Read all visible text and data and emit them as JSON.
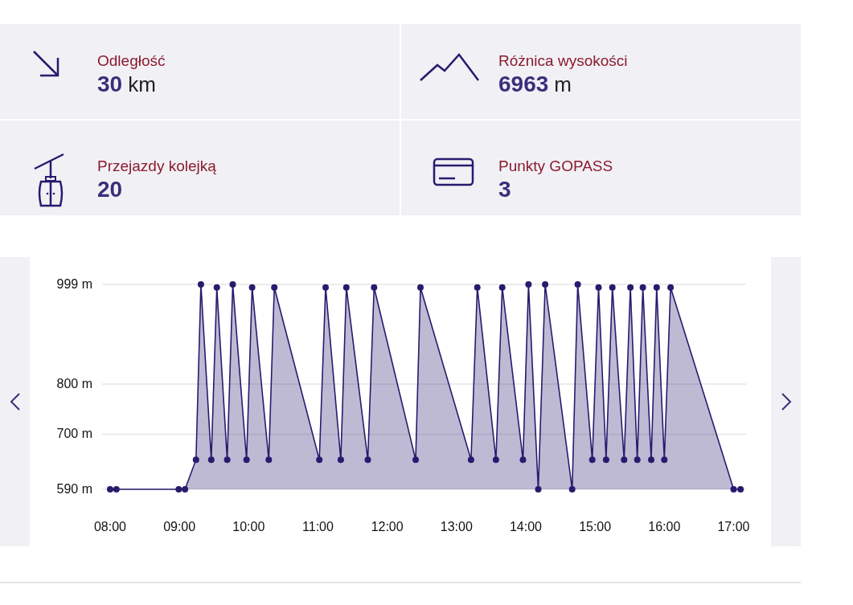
{
  "stats": [
    {
      "kind": "distance",
      "label": "Odległość",
      "value": "30",
      "unit": "km"
    },
    {
      "kind": "elevation",
      "label": "Różnica wysokości",
      "value": "6963",
      "unit": "m"
    },
    {
      "kind": "lift",
      "label": "Przejazdy kolejką",
      "value": "20"
    },
    {
      "kind": "card",
      "label": "Punkty GOPASS",
      "value": "3"
    }
  ],
  "chart": {
    "chart_data": {
      "type": "area",
      "x": [
        8.0,
        8.09,
        8.99,
        9.08,
        9.24,
        9.31,
        9.46,
        9.54,
        9.69,
        9.77,
        9.97,
        10.05,
        10.29,
        10.37,
        11.02,
        11.11,
        11.33,
        11.41,
        11.72,
        11.81,
        12.41,
        12.48,
        13.21,
        13.3,
        13.57,
        13.66,
        13.96,
        14.04,
        14.18,
        14.28,
        14.67,
        14.75,
        14.96,
        15.05,
        15.16,
        15.25,
        15.42,
        15.51,
        15.61,
        15.69,
        15.81,
        15.89,
        16.0,
        16.09,
        17.0,
        17.1
      ],
      "series": [
        {
          "color": "#2a1a6e",
          "values": [
            590,
            590,
            590,
            590,
            649,
            999,
            649,
            993,
            649,
            999,
            649,
            993,
            649,
            993,
            649,
            993,
            649,
            993,
            649,
            993,
            649,
            993,
            649,
            993,
            649,
            993,
            649,
            999,
            590,
            999,
            590,
            999,
            649,
            993,
            649,
            993,
            649,
            993,
            649,
            993,
            649,
            993,
            649,
            993,
            590,
            590
          ]
        }
      ],
      "xlim": [
        7.884,
        17.18
      ],
      "ylim": [
        590,
        999
      ],
      "xticks": [
        {
          "value": 8,
          "label": "08:00"
        },
        {
          "value": 9,
          "label": "09:00"
        },
        {
          "value": 10,
          "label": "10:00"
        },
        {
          "value": 11,
          "label": "11:00"
        },
        {
          "value": 12,
          "label": "12:00"
        },
        {
          "value": 13,
          "label": "13:00"
        },
        {
          "value": 14,
          "label": "14:00"
        },
        {
          "value": 15,
          "label": "15:00"
        },
        {
          "value": 16,
          "label": "16:00"
        },
        {
          "value": 17,
          "label": "17:00"
        }
      ],
      "yticks": [
        {
          "value": 590,
          "label": "590 m"
        },
        {
          "value": 700,
          "label": "700 m"
        },
        {
          "value": 800,
          "label": "800 m"
        },
        {
          "value": 999,
          "label": "999 m"
        }
      ]
    }
  }
}
